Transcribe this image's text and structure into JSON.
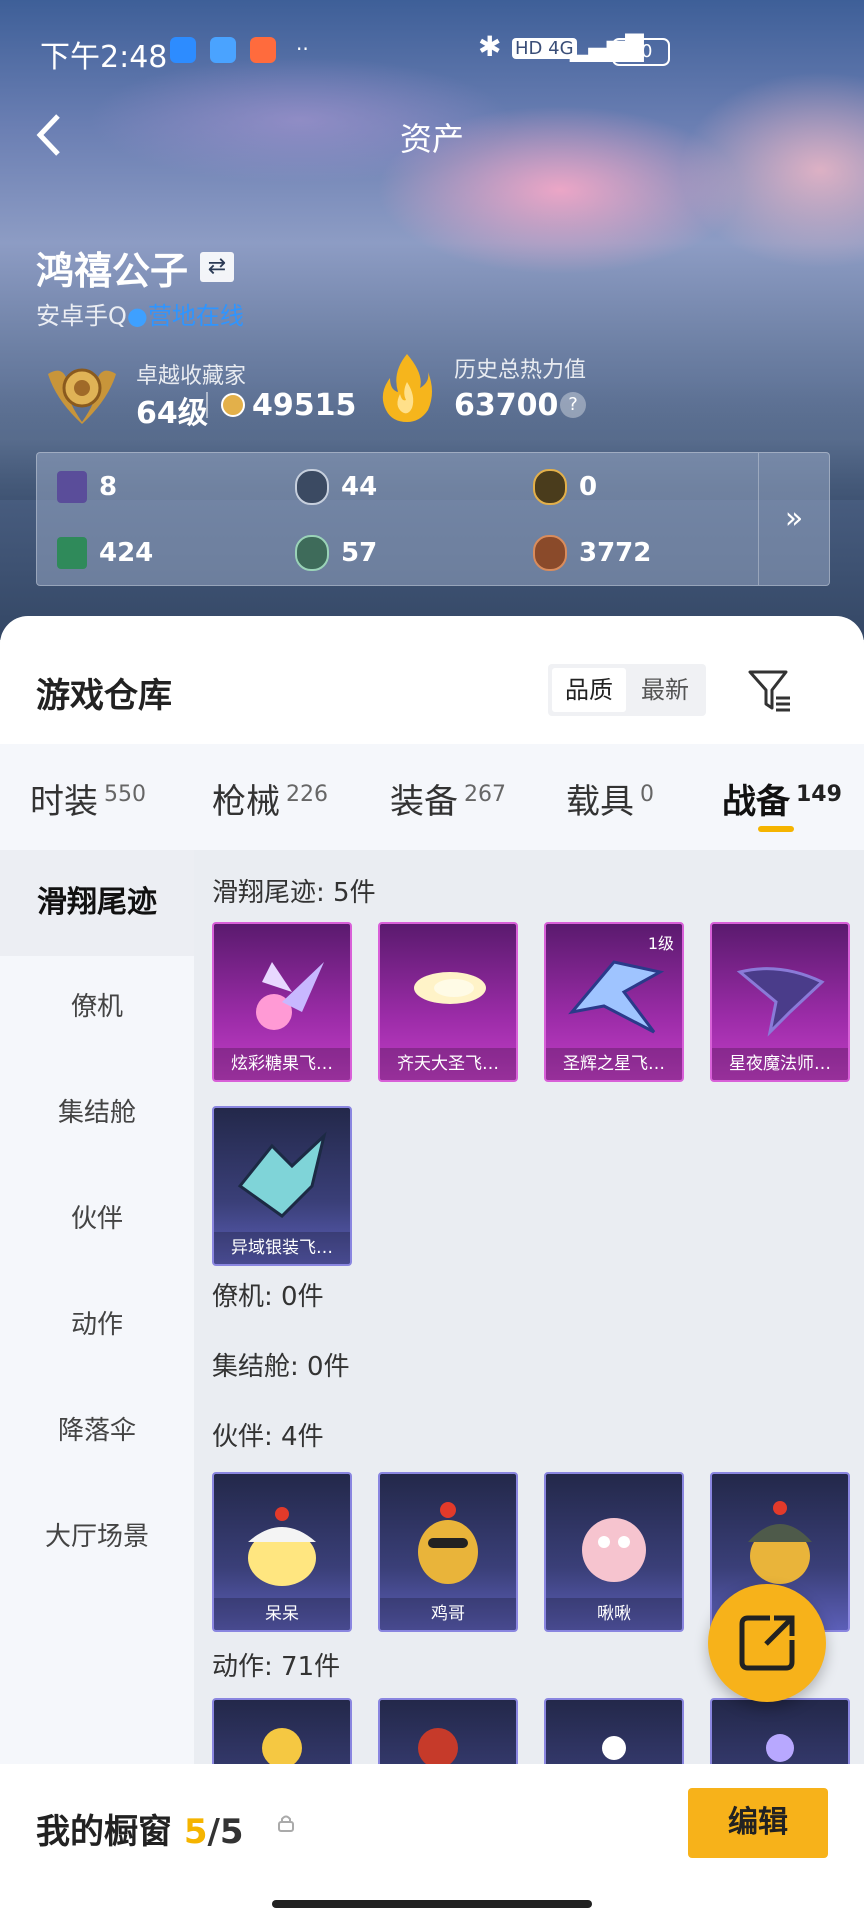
{
  "status_bar": {
    "time": "下午2:48",
    "battery": "90",
    "signal_text": "HD 4G"
  },
  "header": {
    "title": "资产"
  },
  "profile": {
    "name": "鸿禧公子",
    "platform": "安卓手Q",
    "online_status": "营地在线",
    "collector_title": "卓越收藏家",
    "level": "64级",
    "points": "49515",
    "heat_label": "历史总热力值",
    "heat_value": "63700"
  },
  "stats": [
    {
      "icon": "purple-card-icon",
      "value": "8"
    },
    {
      "icon": "silver-coin-icon",
      "value": "44"
    },
    {
      "icon": "gold-coin-icon",
      "value": "0"
    },
    {
      "icon": "green-card-icon",
      "value": "424"
    },
    {
      "icon": "green-orb-icon",
      "value": "57"
    },
    {
      "icon": "bronze-coin-icon",
      "value": "3772"
    }
  ],
  "warehouse": {
    "title": "游戏仓库",
    "sort_options": [
      "品质",
      "最新"
    ],
    "tabs": [
      {
        "label": "时装",
        "count": "550"
      },
      {
        "label": "枪械",
        "count": "226"
      },
      {
        "label": "装备",
        "count": "267"
      },
      {
        "label": "载具",
        "count": "0"
      },
      {
        "label": "战备",
        "count": "149"
      }
    ],
    "sidebar": [
      "滑翔尾迹",
      "僚机",
      "集结舱",
      "伙伴",
      "动作",
      "降落伞",
      "大厅场景"
    ],
    "sections": {
      "glide": "滑翔尾迹: 5件",
      "wingman": "僚机: 0件",
      "capsule": "集结舱: 0件",
      "partner": "伙伴: 4件",
      "action": "动作: 71件"
    },
    "glide_items": [
      "炫彩糖果飞…",
      "齐天大圣飞…",
      "圣辉之星飞…",
      "星夜魔法师…",
      "异域银装飞…"
    ],
    "glide_level": "1级",
    "partner_items": [
      "呆呆",
      "鸡哥",
      "啾啾"
    ]
  },
  "bottom": {
    "label": "我的橱窗",
    "count_current": "5",
    "count_total": "/5",
    "edit_label": "编辑"
  },
  "colors": {
    "accent": "#f7b21a",
    "online": "#2f95ff"
  }
}
